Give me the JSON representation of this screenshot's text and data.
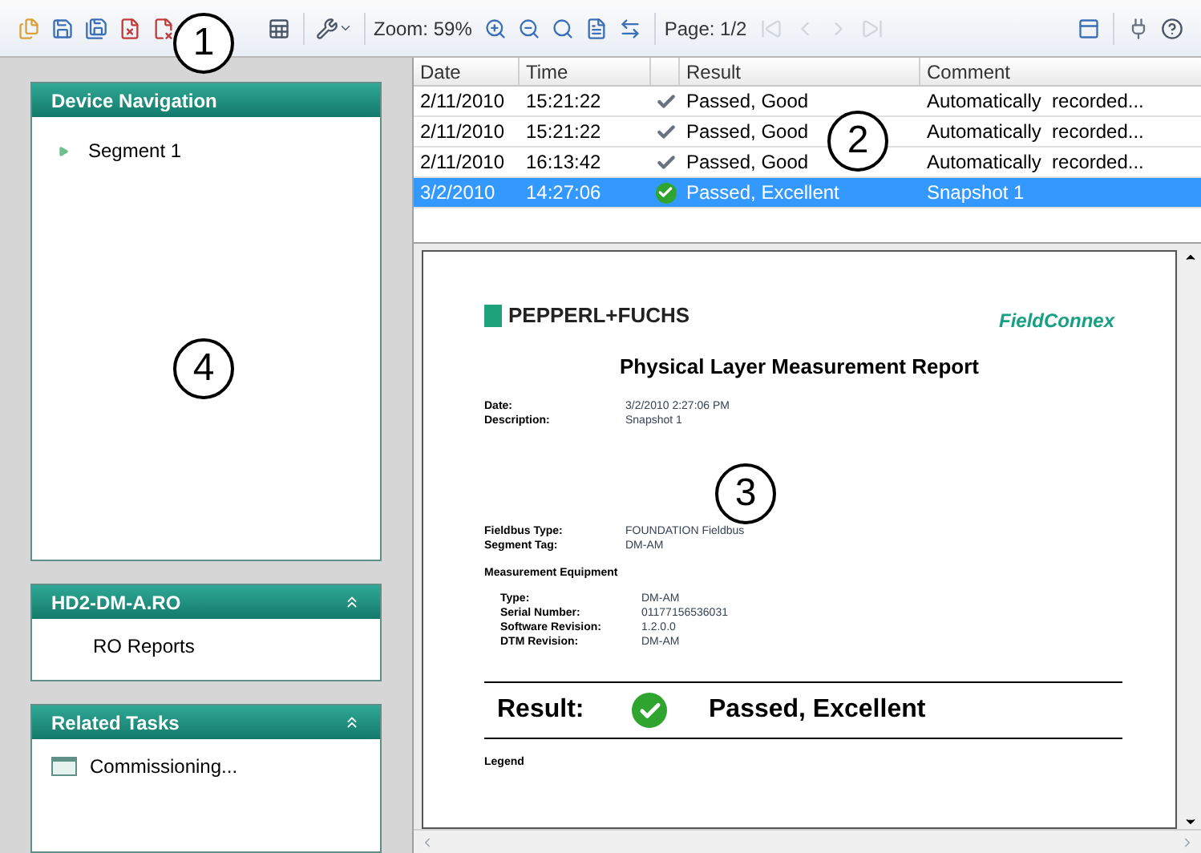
{
  "toolbar": {
    "zoom_label": "Zoom: 59%",
    "page_label": "Page: 1/2",
    "page_nav": [
      {
        "disabled": true
      },
      {
        "disabled": true
      },
      {
        "disabled": true
      },
      {
        "disabled": true
      }
    ]
  },
  "callouts": [
    "1",
    "2",
    "3",
    "4"
  ],
  "sidebar": {
    "panels": [
      {
        "kind": "tree",
        "title": "Device Navigation",
        "items": [
          {
            "label": "Segment 1",
            "expanded": false
          }
        ]
      },
      {
        "kind": "links",
        "title": "HD2-DM-A.RO",
        "collapsible": true,
        "items": [
          {
            "label": "RO Reports",
            "icon": false
          }
        ]
      },
      {
        "kind": "links",
        "title": "Related Tasks",
        "collapsible": true,
        "items": [
          {
            "label": "Commissioning...",
            "icon": true
          }
        ]
      }
    ]
  },
  "table": {
    "columns": [
      "Date",
      "Time",
      "Result",
      "Comment"
    ],
    "rows": [
      {
        "date": "2/11/2010",
        "time": "15:21:22",
        "kind": "good",
        "result": "Passed, Good",
        "comment": "Automatically  recorded...",
        "selected": false
      },
      {
        "date": "2/11/2010",
        "time": "15:21:22",
        "kind": "good",
        "result": "Passed, Good",
        "comment": "Automatically  recorded...",
        "selected": false
      },
      {
        "date": "2/11/2010",
        "time": "16:13:42",
        "kind": "good",
        "result": "Passed, Good",
        "comment": "Automatically  recorded...",
        "selected": false
      },
      {
        "date": "3/2/2010",
        "time": "14:27:06",
        "kind": "excellent",
        "result": "Passed, Excellent",
        "comment": "Snapshot 1",
        "selected": true
      }
    ]
  },
  "report": {
    "company": "PEPPERL+FUCHS",
    "brand": "FieldConnex",
    "title": "Physical Layer Measurement Report",
    "groups": [
      {
        "fields": [
          {
            "label": "Date:",
            "value": "3/2/2010 2:27:06 PM"
          },
          {
            "label": "Description:",
            "value": "Snapshot 1"
          }
        ]
      },
      {
        "fields": [
          {
            "label": "Fieldbus Type:",
            "value": "FOUNDATION Fieldbus"
          },
          {
            "label": "Segment Tag:",
            "value": "DM-AM"
          }
        ]
      }
    ],
    "equipment_heading": "Measurement Equipment",
    "equipment": [
      {
        "label": "Type:",
        "value": "DM-AM"
      },
      {
        "label": "Serial Number:",
        "value": "01177156536031"
      },
      {
        "label": "Software Revision:",
        "value": "1.2.0.0"
      },
      {
        "label": "DTM Revision:",
        "value": "DM-AM"
      }
    ],
    "result": {
      "label": "Result:",
      "kind": "excellent",
      "value": "Passed, Excellent"
    },
    "next_heading": "Legend"
  }
}
